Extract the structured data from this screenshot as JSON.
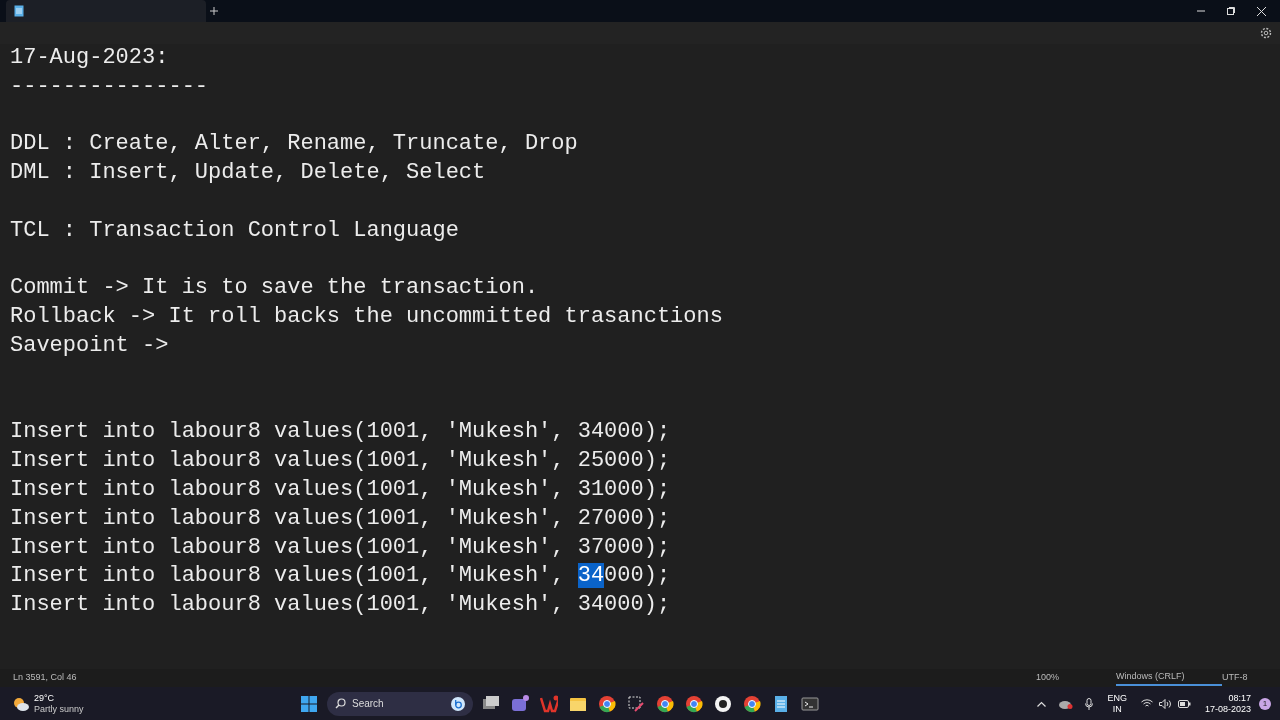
{
  "editor": {
    "lines": [
      {
        "kind": "text",
        "parts": [
          {
            "text": "17-Aug-2023:",
            "selected": false
          }
        ]
      },
      {
        "kind": "text",
        "parts": [
          {
            "text": "---------------",
            "selected": false
          }
        ]
      },
      {
        "kind": "blank"
      },
      {
        "kind": "text",
        "parts": [
          {
            "text": "DDL : Create, Alter, Rename, Truncate, Drop",
            "selected": false
          }
        ]
      },
      {
        "kind": "text",
        "parts": [
          {
            "text": "DML : Insert, Update, Delete, Select",
            "selected": false
          }
        ]
      },
      {
        "kind": "blank"
      },
      {
        "kind": "text",
        "parts": [
          {
            "text": "TCL : Transaction Control Language",
            "selected": false
          }
        ]
      },
      {
        "kind": "blank"
      },
      {
        "kind": "text",
        "parts": [
          {
            "text": "Commit -> It is to save the transaction.",
            "selected": false
          }
        ]
      },
      {
        "kind": "text",
        "parts": [
          {
            "text": "Rollback -> It roll backs the uncommitted trasanctions",
            "selected": false
          }
        ]
      },
      {
        "kind": "text",
        "parts": [
          {
            "text": "Savepoint ->",
            "selected": false
          }
        ]
      },
      {
        "kind": "blank"
      },
      {
        "kind": "blank"
      },
      {
        "kind": "text",
        "parts": [
          {
            "text": "Insert into labour8 values(1001, 'Mukesh', 34000);",
            "selected": false
          }
        ]
      },
      {
        "kind": "text",
        "parts": [
          {
            "text": "Insert into labour8 values(1001, 'Mukesh', 25000);",
            "selected": false
          }
        ]
      },
      {
        "kind": "text",
        "parts": [
          {
            "text": "Insert into labour8 values(1001, 'Mukesh', 31000);",
            "selected": false
          }
        ]
      },
      {
        "kind": "text",
        "parts": [
          {
            "text": "Insert into labour8 values(1001, 'Mukesh', 27000);",
            "selected": false
          }
        ]
      },
      {
        "kind": "text",
        "parts": [
          {
            "text": "Insert into labour8 values(1001, 'Mukesh', 37000);",
            "selected": false
          }
        ]
      },
      {
        "kind": "text",
        "parts": [
          {
            "text": "Insert into labour8 values(1001, 'Mukesh', ",
            "selected": false
          },
          {
            "text": "34",
            "selected": true
          },
          {
            "text": "000);",
            "selected": false
          }
        ]
      },
      {
        "kind": "text",
        "parts": [
          {
            "text": "Insert into labour8 values(1001, 'Mukesh', 34000);",
            "selected": false
          }
        ]
      }
    ]
  },
  "status_bar": {
    "position": "Ln 3591, Col 46",
    "zoom": "100%",
    "line_ending": "Windows (CRLF)",
    "encoding": "UTF-8"
  },
  "taskbar": {
    "weather": {
      "temperature": "29°C",
      "condition": "Partly sunny"
    },
    "search": {
      "placeholder": "Search"
    },
    "language": {
      "line_1": "ENG",
      "line_2": "IN"
    },
    "clock": {
      "time": "08:17",
      "date": "17-08-2023"
    },
    "notification_count": "1"
  }
}
